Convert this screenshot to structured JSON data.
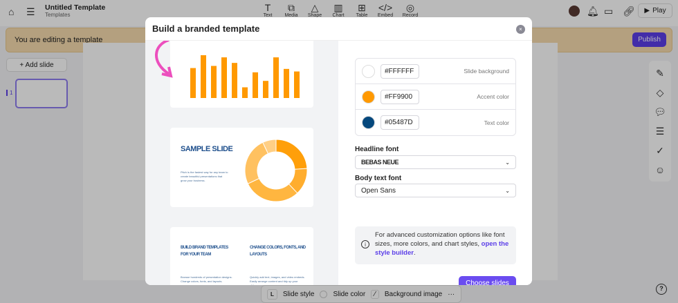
{
  "topbar": {
    "title": "Untitled Template",
    "subtitle": "Templates",
    "tools": [
      {
        "label": "Text",
        "icon": "T"
      },
      {
        "label": "Media",
        "icon": "⧉"
      },
      {
        "label": "Shape",
        "icon": "△"
      },
      {
        "label": "Chart",
        "icon": "▥"
      },
      {
        "label": "Table",
        "icon": "⊞"
      },
      {
        "label": "Embed",
        "icon": "</>"
      },
      {
        "label": "Record",
        "icon": "◎"
      }
    ],
    "play": "Play"
  },
  "banner": {
    "text": "You are editing a template",
    "publish": "Publish"
  },
  "slides": {
    "add": "+ Add slide",
    "number": "1"
  },
  "bottombar": {
    "style_badge": "L",
    "slide_style": "Slide style",
    "slide_color": "Slide color",
    "background_image": "Background image",
    "more": "···"
  },
  "help": "?",
  "modal": {
    "title": "Build a branded template",
    "close": "×",
    "preview": {
      "bar_values": [
        70,
        100,
        75,
        95,
        82,
        25,
        60,
        40,
        95,
        68,
        62
      ],
      "sample_title": "Sample slide",
      "sample_text": "Pitch is the fastest way for any team to create beautiful presentations that grow your business.",
      "donut_values": [
        24,
        14,
        30,
        25,
        7
      ],
      "col1_title": "Build brand templates for your team",
      "col1_text": "Browse hundreds of presentation designs. Change colors, fonts, and layouts.",
      "col2_title": "Change colors, fonts, and layouts",
      "col2_text": "Quickly add text, images, and video embeds. Easily arrange content and tidy up your slides."
    },
    "colors": [
      {
        "hex": "#FFFFFF",
        "label": "Slide background"
      },
      {
        "hex": "#FF9900",
        "label": "Accent color"
      },
      {
        "hex": "#05487D",
        "label": "Text color"
      }
    ],
    "headline_label": "Headline font",
    "headline_value": "BEBAS NEUE",
    "body_label": "Body text font",
    "body_value": "Open Sans",
    "info_text": "For advanced customization options like font sizes, more colors, and chart styles, ",
    "info_link": "open the style builder",
    "info_end": ".",
    "choose": "Choose slides"
  },
  "accent": "#FF9900",
  "brand": "#5B3EE8"
}
